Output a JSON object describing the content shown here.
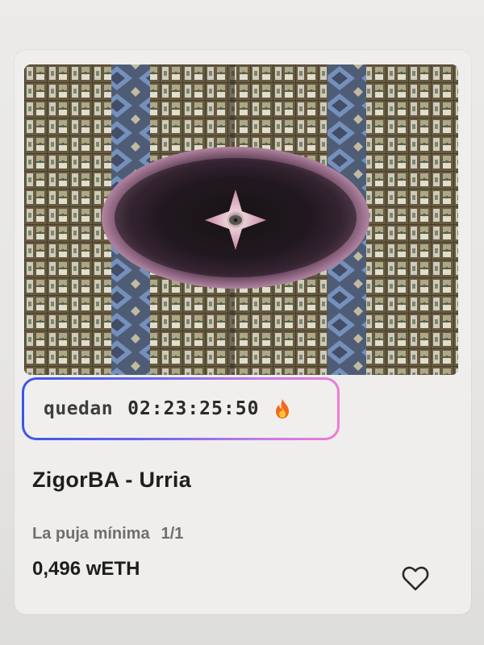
{
  "timer": {
    "label": "quedan",
    "time": "02:23:25:50",
    "icon": "fire-icon"
  },
  "item": {
    "title": "ZigorBA - Urria",
    "bid_label": "La puja mínima",
    "edition": "1/1",
    "price": "0,496 wETH"
  },
  "actions": {
    "favorite_icon": "heart-outline-icon"
  },
  "colors": {
    "border_gradient_start": "#3b56e8",
    "border_gradient_end": "#f07ad6",
    "text_primary": "#1e1e1e",
    "text_secondary": "#6f6f6f"
  }
}
